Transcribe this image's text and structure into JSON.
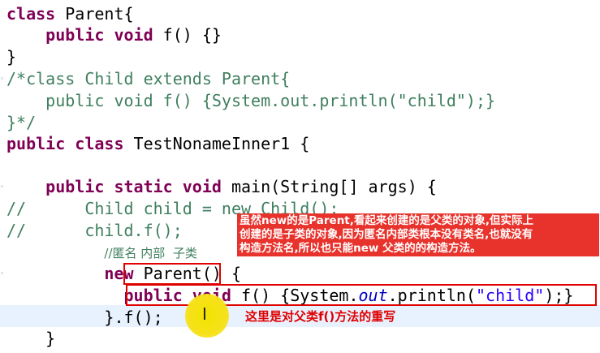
{
  "code": {
    "l1": {
      "kw": "class",
      "rest": " Parent{"
    },
    "l2": {
      "indent": "    ",
      "kw1": "public",
      "sp": " ",
      "kw2": "void",
      "rest": " f() {}"
    },
    "l3": {
      "rest": "}"
    },
    "l4": {
      "text": "/*class Child extends Parent{"
    },
    "l5": {
      "text": "    public void f() {System.out.println(\"child\");}"
    },
    "l6": {
      "text": "}*/"
    },
    "l7": {
      "kw1": "public",
      "kw2": "class",
      "rest": " TestNonameInner1 {"
    },
    "l9": {
      "indent": "    ",
      "kw1": "public",
      "kw2": "static",
      "kw3": "void",
      "rest": " main(String[] args) {"
    },
    "l10": {
      "text": "//      Child child = new Child();"
    },
    "l11": {
      "text": "//      child.f();"
    },
    "l12": {
      "indent": "          ",
      "text": "//匿名 内部  子类"
    },
    "l13": {
      "indent": "          ",
      "kw": "new",
      "rest": " Parent() {"
    },
    "l14": {
      "indent": "            ",
      "kw1": "public",
      "kw2": "void",
      "pre": " f() {System.",
      "field": "out",
      "mid": ".println(",
      "str": "\"child\"",
      "end": ");}"
    },
    "l15": {
      "indent": "          ",
      "rest": "}.f();"
    },
    "l16": {
      "indent": "    ",
      "rest": "}"
    }
  },
  "annotations": {
    "note1": "虽然new的是Parent,看起来创建的是父类的对象,但实际上\n创建的是子类的对象,因为匿名内部类根本没有类名,也就没有\n构造方法名,所以也只能new 父类的的构造方法。",
    "note2": "这里是对父类f()方法的重写"
  },
  "colors": {
    "keyword": "#7f0055",
    "string": "#2a00ff",
    "comment": "#3f7f5f",
    "field": "#0000c0",
    "highlight_box": "#e00000",
    "annotation_bg": "#e8322c"
  },
  "icons": [
    "fold-marker-icon",
    "text-cursor-icon",
    "mouse-highlight-icon"
  ]
}
